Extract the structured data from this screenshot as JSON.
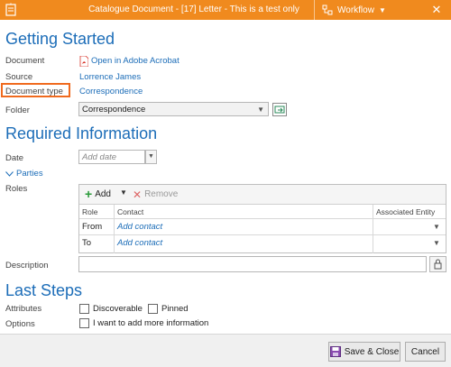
{
  "window": {
    "title": "Catalogue Document - [17] Letter - This is a test only",
    "workflow_label": "Workflow",
    "close_glyph": "✕"
  },
  "getting_started": {
    "heading": "Getting Started",
    "document_label": "Document",
    "document_link": "Open in Adobe Acrobat",
    "source_label": "Source",
    "source_value": "Lorrence James",
    "doctype_label": "Document type",
    "doctype_value": "Correspondence",
    "folder_label": "Folder",
    "folder_value": "Correspondence"
  },
  "required": {
    "heading": "Required Information",
    "date_label": "Date",
    "date_placeholder": "Add date",
    "parties_label": "Parties",
    "roles_label": "Roles",
    "toolbar": {
      "add_label": "Add",
      "remove_label": "Remove"
    },
    "columns": [
      "Role",
      "Contact",
      "Associated Entity"
    ],
    "rows": [
      {
        "role": "From",
        "contact": "Add contact"
      },
      {
        "role": "To",
        "contact": "Add contact"
      }
    ],
    "description_label": "Description",
    "description_value": ""
  },
  "last_steps": {
    "heading": "Last Steps",
    "attributes_label": "Attributes",
    "discoverable_label": "Discoverable",
    "pinned_label": "Pinned",
    "options_label": "Options",
    "more_info_label": "I want to add more information"
  },
  "footer": {
    "save_label": "Save & Close",
    "cancel_label": "Cancel"
  },
  "colors": {
    "titlebar": "#f08a1e",
    "accent": "#1c6db8",
    "highlight": "#f06a1e"
  }
}
